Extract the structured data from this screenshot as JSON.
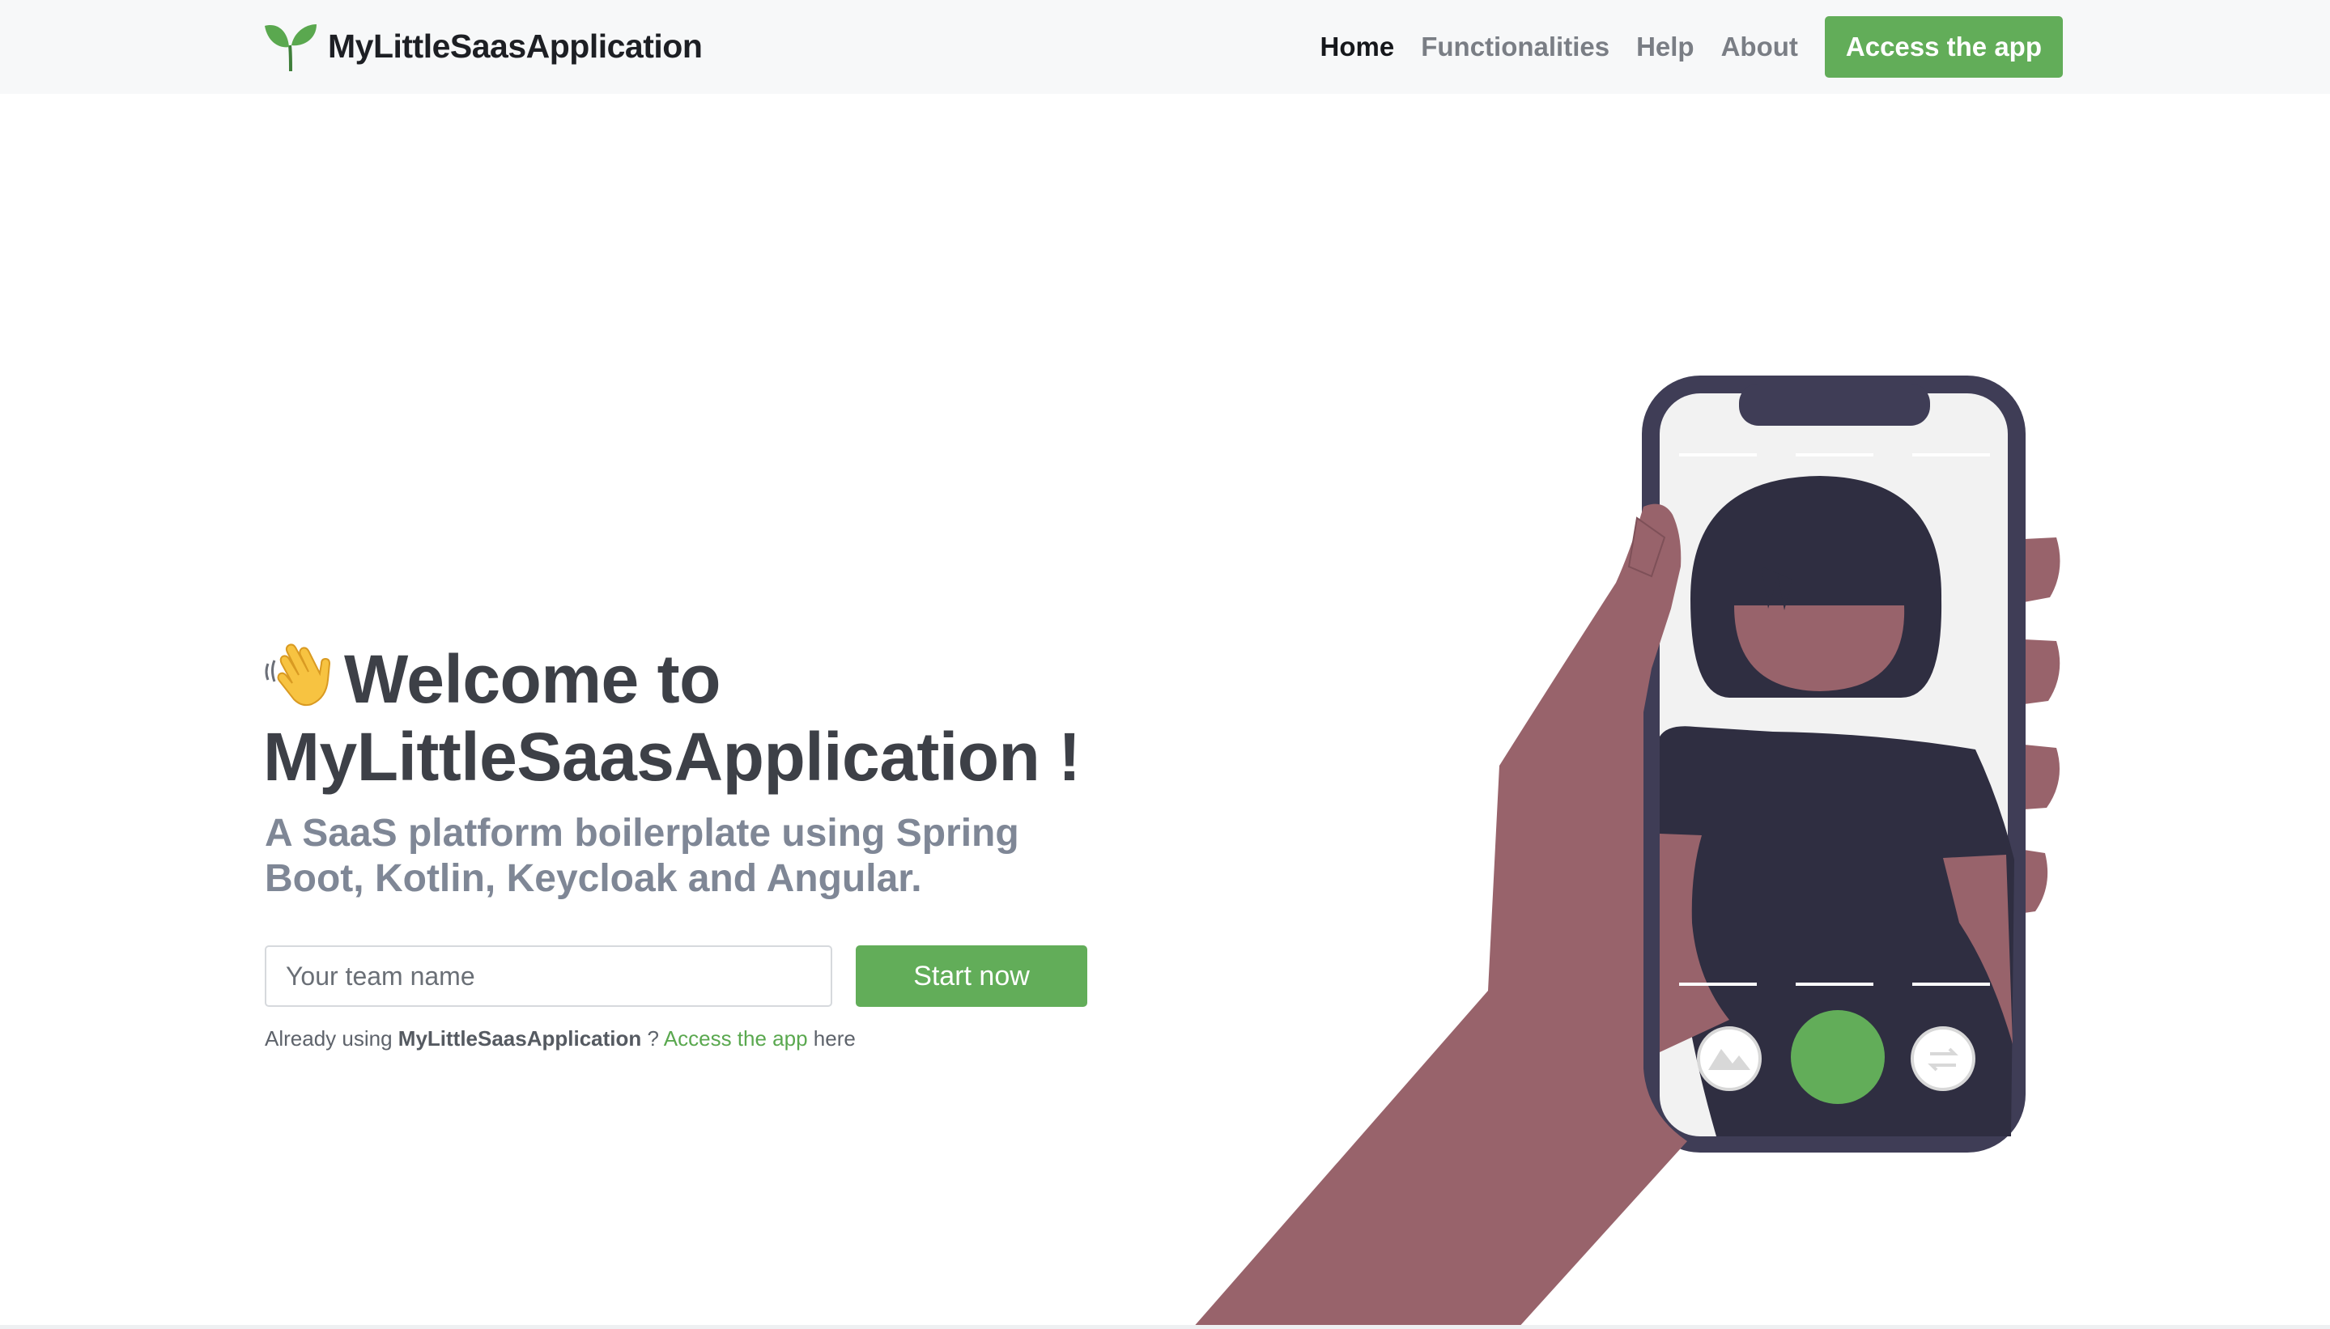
{
  "navbar": {
    "brand_name": "MyLittleSaasApplication",
    "brand_icon": "sprout-icon",
    "links": [
      {
        "label": "Home",
        "active": true
      },
      {
        "label": "Functionalities",
        "active": false
      },
      {
        "label": "Help",
        "active": false
      },
      {
        "label": "About",
        "active": false
      }
    ],
    "cta_label": "Access the app"
  },
  "hero": {
    "wave_icon": "waving-hand-icon",
    "title": "Welcome to MyLittleSaasApplication !",
    "subtitle": "A SaaS platform boilerplate using Spring Boot, Kotlin, Keycloak and Angular.",
    "team_input": {
      "placeholder": "Your team name",
      "value": ""
    },
    "start_button_label": "Start now",
    "already_prefix": "Already using",
    "already_app_name": "MyLittleSaasApplication",
    "already_question": "?",
    "already_link": "Access the app",
    "already_suffix": "here"
  },
  "illustration": {
    "icon": "hand-holding-phone-illustration",
    "phone_buttons": [
      "gallery-icon",
      "shutter-button",
      "switch-camera-icon"
    ]
  },
  "colors": {
    "accent": "#62ad59",
    "title": "#3d4047",
    "subtitle": "#7f8796",
    "skin": "#98636b",
    "phone_frame": "#3f3d56",
    "dark_figure": "#2f2e41"
  }
}
